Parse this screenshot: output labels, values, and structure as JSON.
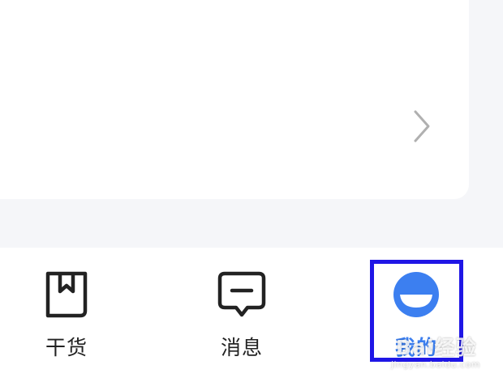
{
  "tabs": [
    {
      "label": "干货",
      "icon": "notebook-icon",
      "active": false
    },
    {
      "label": "消息",
      "icon": "message-icon",
      "active": false
    },
    {
      "label": "我的",
      "icon": "smiley-icon",
      "active": true
    }
  ],
  "colors": {
    "background": "#f5f6f9",
    "card": "#ffffff",
    "active": "#3c7ff0",
    "icon": "#222222",
    "chevron": "#b0b0b0",
    "highlight": "#1f16e6"
  },
  "watermark": {
    "main": "Bai经验",
    "sub": "jingyan.baidu.com"
  }
}
